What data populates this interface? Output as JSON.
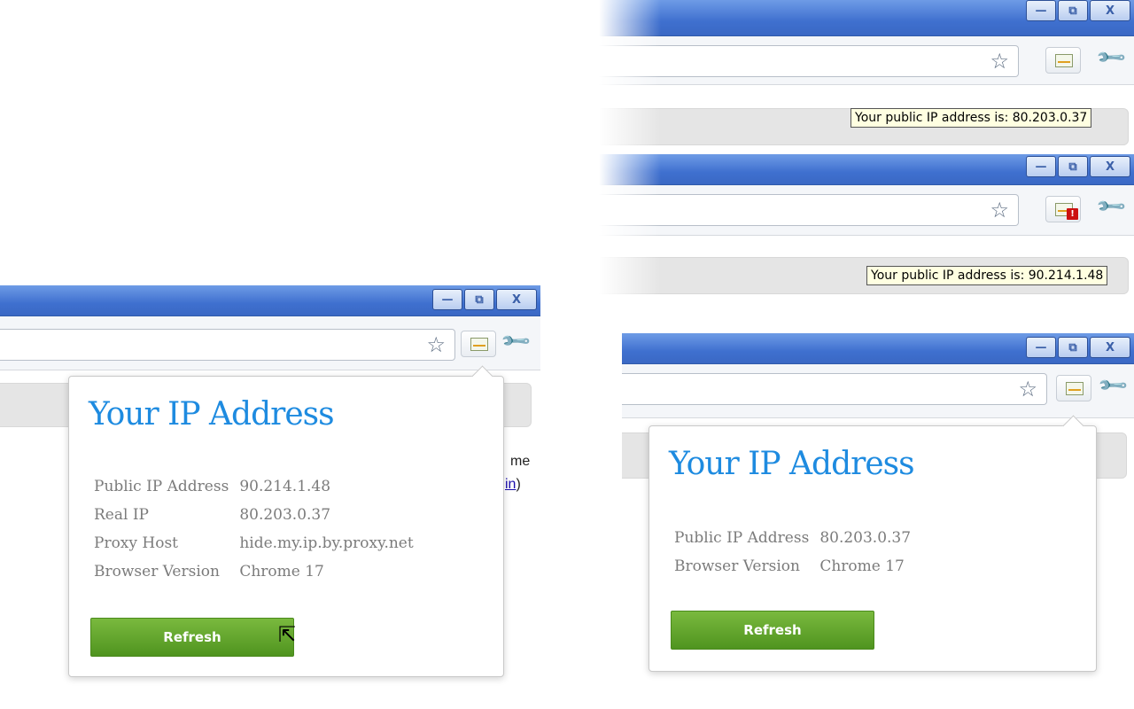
{
  "window_controls": {
    "minimize": "—",
    "restore": "⧉",
    "close": "X"
  },
  "toolbar": {
    "bookmark_icon": "☆",
    "extension_icon": "ip-address-icon",
    "wrench_icon": "🔧",
    "alert_badge": "!"
  },
  "tooltip_1": "Your public IP address is: 80.203.0.37",
  "tooltip_2": "Your public IP address is: 90.214.1.48",
  "background_page": {
    "text_fragment": "me",
    "link_fragment": "in",
    "close_paren": ")"
  },
  "popup_1": {
    "title": "Your IP Address",
    "rows": [
      {
        "label": "Public IP Address",
        "value": "90.214.1.48"
      },
      {
        "label": "Real IP",
        "value": "80.203.0.37"
      },
      {
        "label": "Proxy Host",
        "value": "hide.my.ip.by.proxy.net"
      },
      {
        "label": "Browser Version",
        "value": "Chrome 17"
      }
    ],
    "button": "Refresh"
  },
  "popup_2": {
    "title": "Your IP Address",
    "rows": [
      {
        "label": "Public IP Address",
        "value": "80.203.0.37"
      },
      {
        "label": "Browser Version",
        "value": "Chrome 17"
      }
    ],
    "button": "Refresh"
  },
  "colors": {
    "title_blue": "#1e8be0",
    "button_green": "#5fa32a",
    "titlebar_blue": "#3f70cf"
  }
}
